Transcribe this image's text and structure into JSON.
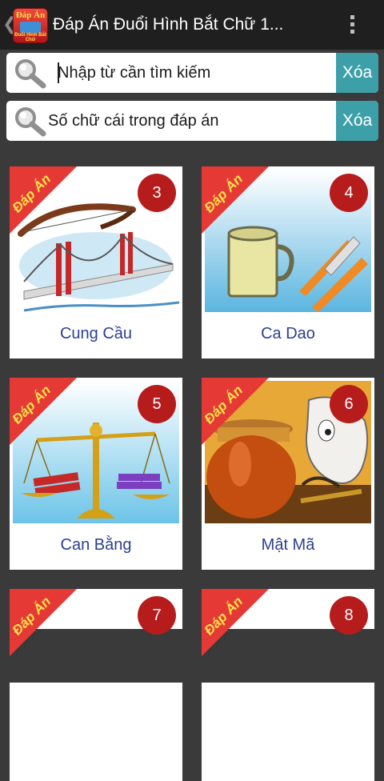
{
  "app": {
    "title": "Đáp Án Đuổi Hình Bắt Chữ 1...",
    "icon_text_top": "Đáp Án",
    "icon_text_bottom": "Đuổi Hình Bắt Chữ"
  },
  "search": {
    "keyword_placeholder": "Nhập từ cần tìm kiếm",
    "letters_placeholder": "Số chữ cái trong đáp án",
    "clear_label": "Xóa"
  },
  "ribbon_label": "Đáp Án",
  "cards": [
    {
      "number": "3",
      "name": "Cung Cầu",
      "image": "bow-over-bridge"
    },
    {
      "number": "4",
      "name": "Ca Dao",
      "image": "mug-and-knives"
    },
    {
      "number": "5",
      "name": "Can Bằng",
      "image": "balance-scale"
    },
    {
      "number": "6",
      "name": "Mật Mã",
      "image": "honey-jar-and-horse"
    },
    {
      "number": "7",
      "name": "",
      "image": ""
    },
    {
      "number": "8",
      "name": "",
      "image": ""
    }
  ],
  "colors": {
    "background": "#3a3a3a",
    "action_bar": "#1f1f1f",
    "clear_button": "#3da0a8",
    "ribbon": "#e53935",
    "badge": "#b71c1c",
    "card_title": "#2c3f8c"
  }
}
